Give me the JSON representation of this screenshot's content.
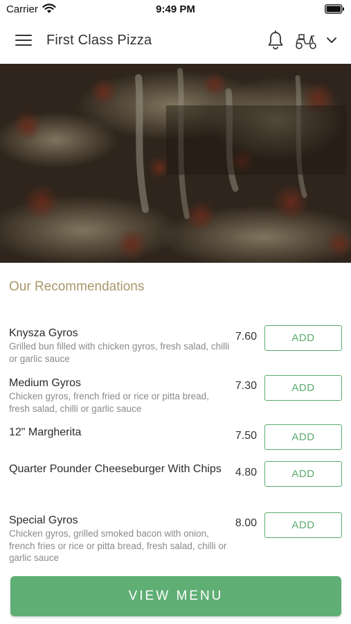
{
  "status_bar": {
    "carrier": "Carrier",
    "time": "9:49 PM",
    "icons": [
      "wifi-icon",
      "battery-icon"
    ]
  },
  "header": {
    "title": "First Class Pizza",
    "icons": [
      "menu-icon",
      "bell-icon",
      "scooter-icon",
      "chevron-down-icon"
    ]
  },
  "colors": {
    "accent_green": "#5fae74",
    "section_title": "#a9976a"
  },
  "recommendations": {
    "title": "Our Recommendations",
    "items": [
      {
        "name": "Knysza Gyros",
        "description": "Grilled bun filled with chicken gyros, fresh salad, chilli or garlic sauce",
        "price": "7.60",
        "button": "ADD"
      },
      {
        "name": "Medium Gyros",
        "description": "Chicken gyros, french fried or rice or pitta bread, fresh salad, chilli or garlic sauce",
        "price": "7.30",
        "button": "ADD"
      },
      {
        "name": "12\" Margherita",
        "description": "",
        "price": "7.50",
        "button": "ADD"
      },
      {
        "name": "Quarter Pounder Cheeseburger With Chips",
        "description": "",
        "price": "4.80",
        "button": "ADD"
      },
      {
        "name": "Special Gyros",
        "description": "Chicken gyros, grilled smoked bacon with onion, french fries or rice or pitta bread, fresh salad, chilli or garlic sauce",
        "price": "8.00",
        "button": "ADD"
      }
    ]
  },
  "footer": {
    "view_menu_label": "VIEW MENU"
  }
}
